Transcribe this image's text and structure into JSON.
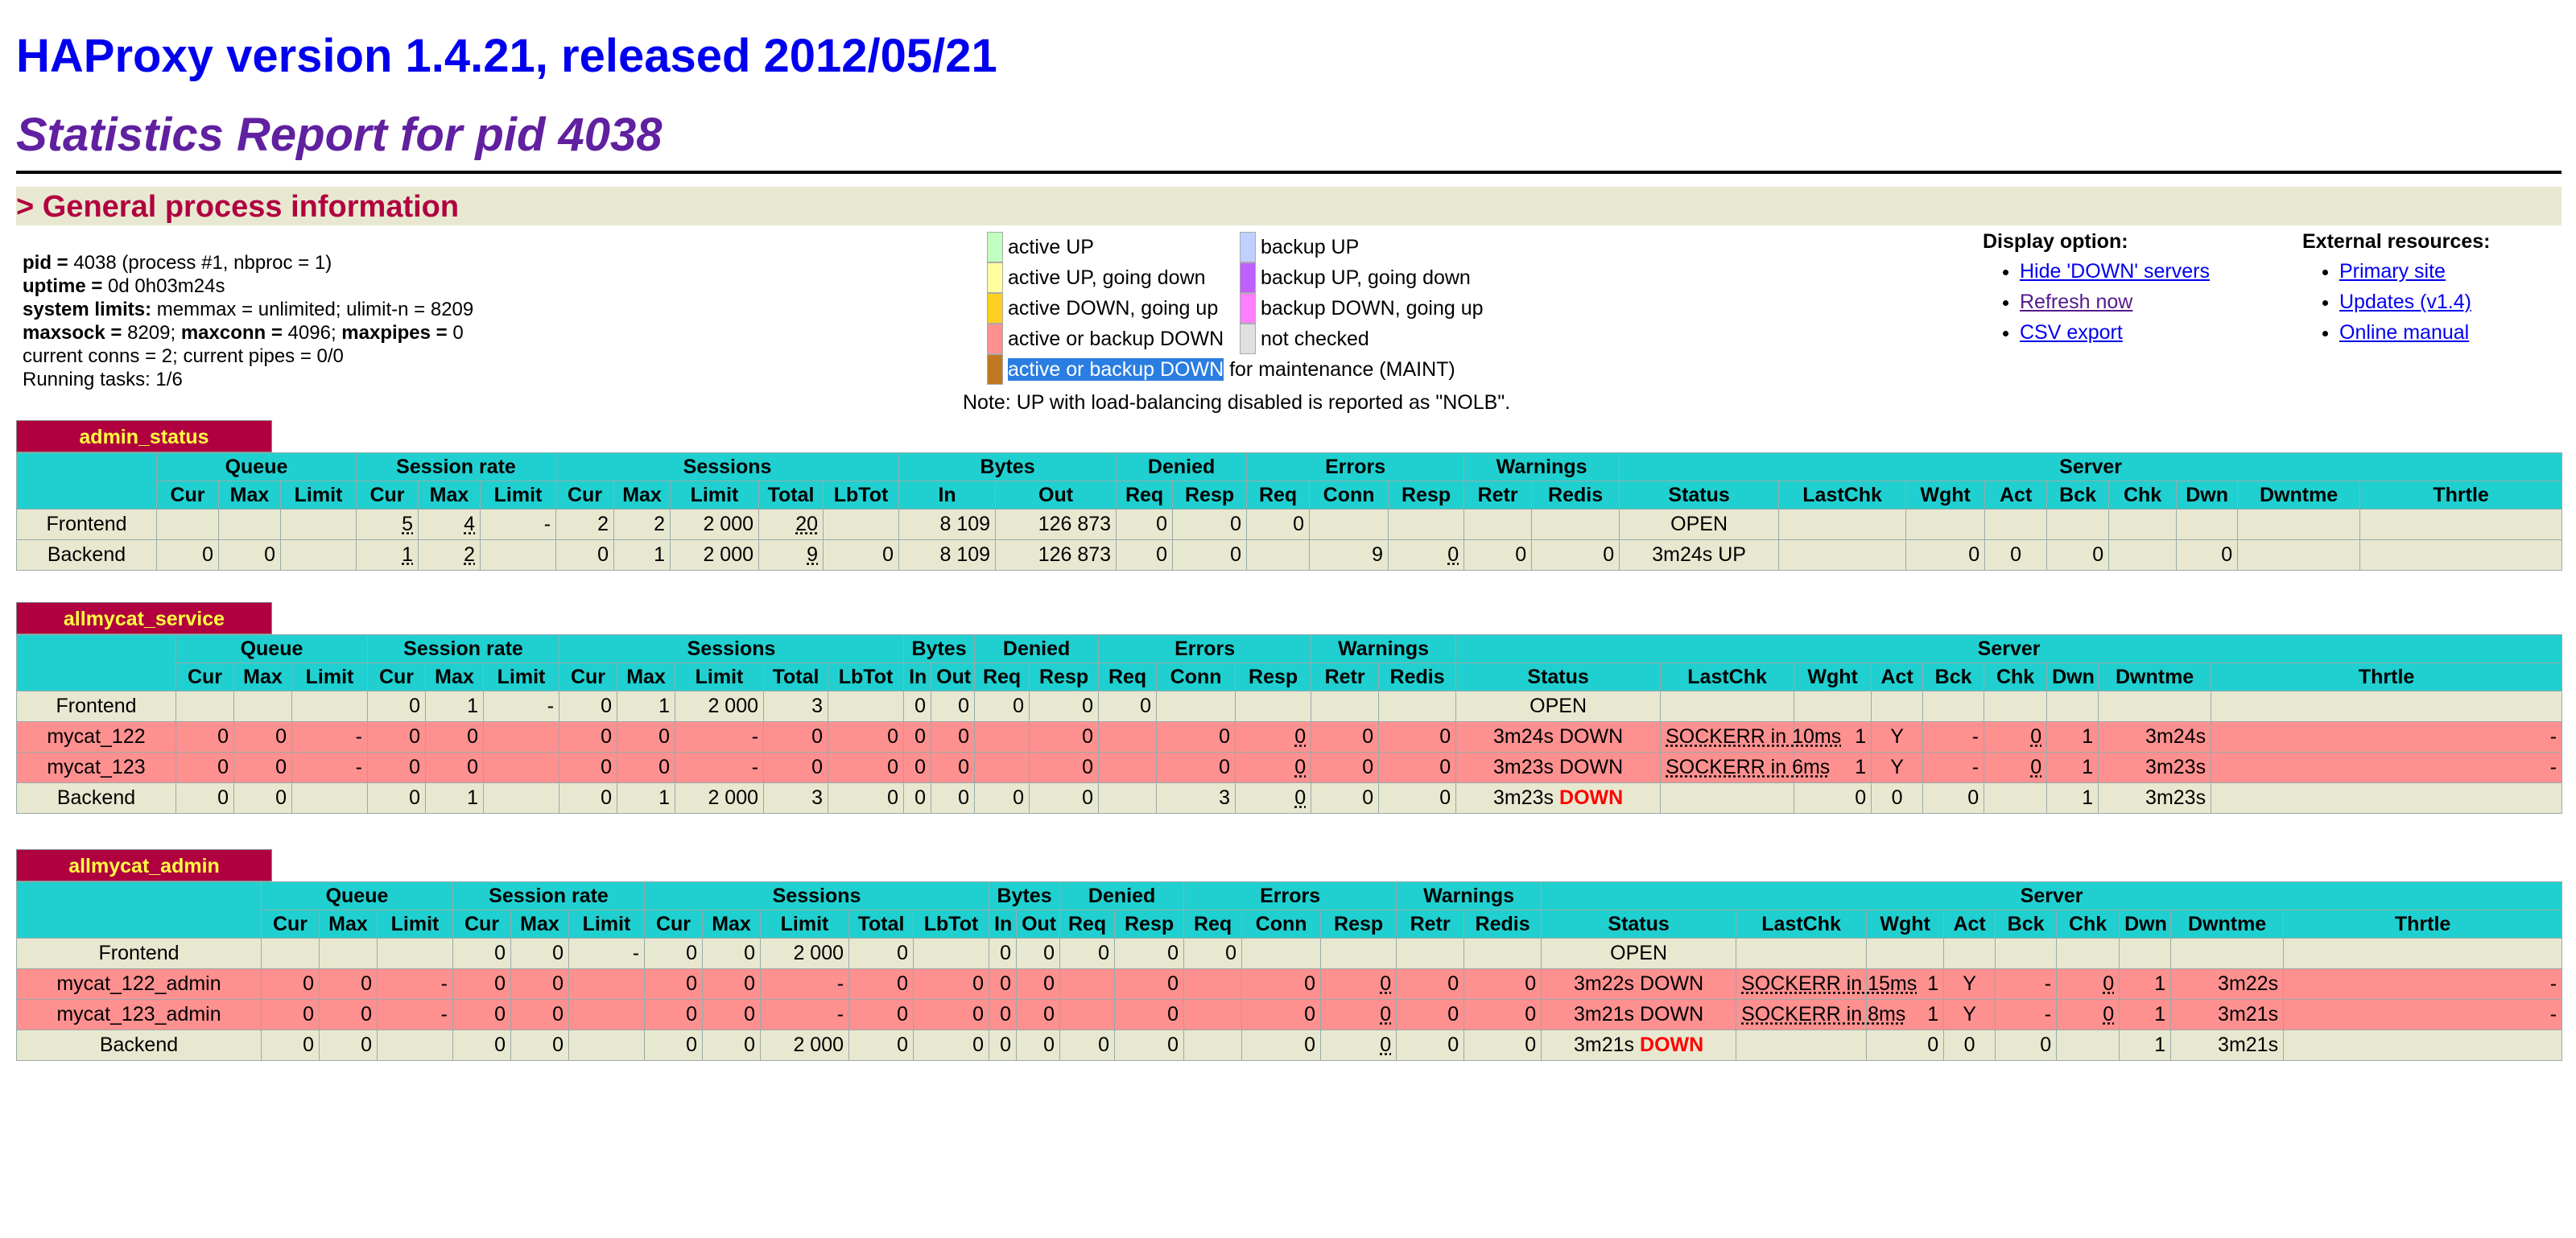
{
  "header": {
    "title": "HAProxy version 1.4.21, released 2012/05/21",
    "subtitle": "Statistics Report for pid 4038",
    "section": "> General process information"
  },
  "info": {
    "pid_label": "pid = ",
    "pid_value": "4038 (process #1, nbproc = 1)",
    "uptime_label": "uptime = ",
    "uptime_value": "0d 0h03m24s",
    "syslim_label": "system limits:",
    "syslim_value": " memmax = unlimited; ulimit-n = 8209",
    "maxsock_label": "maxsock = ",
    "maxsock_value": "8209; ",
    "maxconn_label": "maxconn = ",
    "maxconn_value": "4096; ",
    "maxpipes_label": "maxpipes = ",
    "maxpipes_value": "0",
    "conns": "current conns = 2; current pipes = 0/0",
    "tasks": "Running tasks: 1/6"
  },
  "legend": {
    "items_left": [
      {
        "label": "active UP",
        "color": "#c0ffc0"
      },
      {
        "label": "active UP, going down",
        "color": "#ffffa0"
      },
      {
        "label": "active DOWN, going up",
        "color": "#ffd020"
      },
      {
        "label": "active or backup DOWN",
        "color": "#ff9090"
      }
    ],
    "items_right": [
      {
        "label": "backup UP",
        "color": "#c0d0ff"
      },
      {
        "label": "backup UP, going down",
        "color": "#c060ff"
      },
      {
        "label": "backup DOWN, going up",
        "color": "#ff80ff"
      },
      {
        "label": "not checked",
        "color": "#e0e0e0"
      }
    ],
    "maint_highlight": "active or backup DOWN",
    "maint_rest": " for maintenance (MAINT)",
    "maint_color": "#c07820",
    "note": "Note: UP with load-balancing disabled is reported as \"NOLB\"."
  },
  "display_options": {
    "title": "Display option:",
    "links": [
      "Hide 'DOWN' servers",
      "Refresh now",
      "CSV export"
    ]
  },
  "external": {
    "title": "External resources:",
    "links": [
      "Primary site",
      "Updates (v1.4)",
      "Online manual"
    ]
  },
  "headers": {
    "groups": [
      "Queue",
      "Session rate",
      "Sessions",
      "Bytes",
      "Denied",
      "Errors",
      "Warnings",
      "Server"
    ],
    "cols": [
      "Cur",
      "Max",
      "Limit",
      "Cur",
      "Max",
      "Limit",
      "Cur",
      "Max",
      "Limit",
      "Total",
      "LbTot",
      "In",
      "Out",
      "Req",
      "Resp",
      "Req",
      "Conn",
      "Resp",
      "Retr",
      "Redis",
      "Status",
      "LastChk",
      "Wght",
      "Act",
      "Bck",
      "Chk",
      "Dwn",
      "Dwntme",
      "Thrtle"
    ]
  },
  "proxies": [
    {
      "name": "admin_status",
      "rows": [
        {
          "name": "Frontend",
          "cells": [
            "",
            "",
            "",
            "5",
            "4",
            "-",
            "2",
            "2",
            "2 000",
            "20",
            "",
            "8 109",
            "126 873",
            "0",
            "0",
            "0",
            "",
            "",
            "",
            "",
            "OPEN",
            "",
            "",
            "",
            "",
            "",
            "",
            "",
            ""
          ]
        },
        {
          "name": "Backend",
          "cells": [
            "0",
            "0",
            "",
            "1",
            "2",
            "",
            "0",
            "1",
            "2 000",
            "9",
            "0",
            "8 109",
            "126 873",
            "0",
            "0",
            "",
            "9",
            "0",
            "0",
            "0",
            "3m24s UP",
            "",
            "0",
            "0",
            "0",
            "",
            "0",
            "",
            ""
          ]
        }
      ]
    },
    {
      "name": "allmycat_service",
      "rows": [
        {
          "name": "Frontend",
          "cells": [
            "",
            "",
            "",
            "0",
            "1",
            "-",
            "0",
            "1",
            "2 000",
            "3",
            "",
            "0",
            "0",
            "0",
            "0",
            "0",
            "",
            "",
            "",
            "",
            "OPEN",
            "",
            "",
            "",
            "",
            "",
            "",
            "",
            ""
          ]
        },
        {
          "name": "mycat_122",
          "cells": [
            "0",
            "0",
            "-",
            "0",
            "0",
            "",
            "0",
            "0",
            "-",
            "0",
            "0",
            "0",
            "0",
            "",
            "0",
            "",
            "0",
            "0",
            "0",
            "0",
            "3m24s DOWN",
            "SOCKERR in 10ms",
            "1",
            "Y",
            "-",
            "0",
            "1",
            "3m24s",
            "-"
          ]
        },
        {
          "name": "mycat_123",
          "cells": [
            "0",
            "0",
            "-",
            "0",
            "0",
            "",
            "0",
            "0",
            "-",
            "0",
            "0",
            "0",
            "0",
            "",
            "0",
            "",
            "0",
            "0",
            "0",
            "0",
            "3m23s DOWN",
            "SOCKERR in 6ms",
            "1",
            "Y",
            "-",
            "0",
            "1",
            "3m23s",
            "-"
          ]
        },
        {
          "name": "Backend",
          "cells": [
            "0",
            "0",
            "",
            "0",
            "1",
            "",
            "0",
            "1",
            "2 000",
            "3",
            "0",
            "0",
            "0",
            "0",
            "0",
            "",
            "3",
            "0",
            "0",
            "0",
            "3m23s",
            "",
            "0",
            "0",
            "0",
            "",
            "1",
            "3m23s",
            ""
          ]
        }
      ]
    },
    {
      "name": "allmycat_admin",
      "rows": [
        {
          "name": "Frontend",
          "cells": [
            "",
            "",
            "",
            "0",
            "0",
            "-",
            "0",
            "0",
            "2 000",
            "0",
            "",
            "0",
            "0",
            "0",
            "0",
            "0",
            "",
            "",
            "",
            "",
            "OPEN",
            "",
            "",
            "",
            "",
            "",
            "",
            "",
            ""
          ]
        },
        {
          "name": "mycat_122_admin",
          "cells": [
            "0",
            "0",
            "-",
            "0",
            "0",
            "",
            "0",
            "0",
            "-",
            "0",
            "0",
            "0",
            "0",
            "",
            "0",
            "",
            "0",
            "0",
            "0",
            "0",
            "3m22s DOWN",
            "SOCKERR in 15ms",
            "1",
            "Y",
            "-",
            "0",
            "1",
            "3m22s",
            "-"
          ]
        },
        {
          "name": "mycat_123_admin",
          "cells": [
            "0",
            "0",
            "-",
            "0",
            "0",
            "",
            "0",
            "0",
            "-",
            "0",
            "0",
            "0",
            "0",
            "",
            "0",
            "",
            "0",
            "0",
            "0",
            "0",
            "3m21s DOWN",
            "SOCKERR in 8ms",
            "1",
            "Y",
            "-",
            "0",
            "1",
            "3m21s",
            "-"
          ]
        },
        {
          "name": "Backend",
          "cells": [
            "0",
            "0",
            "",
            "0",
            "0",
            "",
            "0",
            "0",
            "2 000",
            "0",
            "0",
            "0",
            "0",
            "0",
            "0",
            "",
            "0",
            "0",
            "0",
            "0",
            "3m21s",
            "",
            "0",
            "0",
            "0",
            "",
            "1",
            "3m21s",
            ""
          ]
        }
      ]
    }
  ],
  "down_word": "DOWN",
  "colors": {
    "header_cyan": "#20d0d0",
    "row_beige": "#e8e8d0",
    "row_down": "#ff9090",
    "proxy_tab": "#b00040"
  }
}
